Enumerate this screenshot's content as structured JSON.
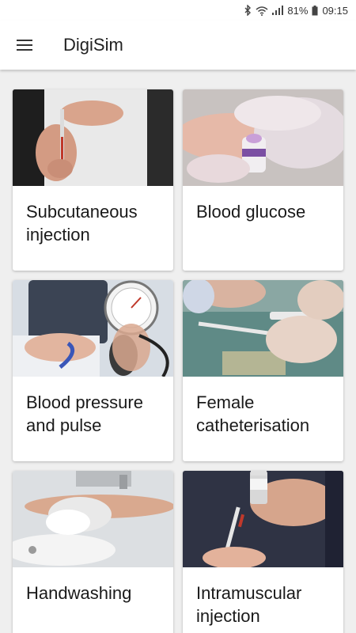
{
  "status_bar": {
    "icons": [
      "bluetooth-icon",
      "wifi-icon",
      "signal-icon",
      "battery-icon"
    ],
    "battery": "81%",
    "time": "09:15"
  },
  "app_bar": {
    "menu_icon": "hamburger-menu-icon",
    "title": "DigiSim"
  },
  "cards": [
    {
      "label": "Subcutaneous injection",
      "image": "syringe-in-hand-photo"
    },
    {
      "label": "Blood glucose",
      "image": "finger-prick-lancet-photo"
    },
    {
      "label": "Blood pressure and pulse",
      "image": "sphygmomanometer-cuff-photo"
    },
    {
      "label": "Female catheterisation",
      "image": "catheter-syringe-photo"
    },
    {
      "label": "Handwashing",
      "image": "hands-washing-at-sink-photo"
    },
    {
      "label": "Intramuscular injection",
      "image": "vial-and-syringe-photo"
    }
  ]
}
